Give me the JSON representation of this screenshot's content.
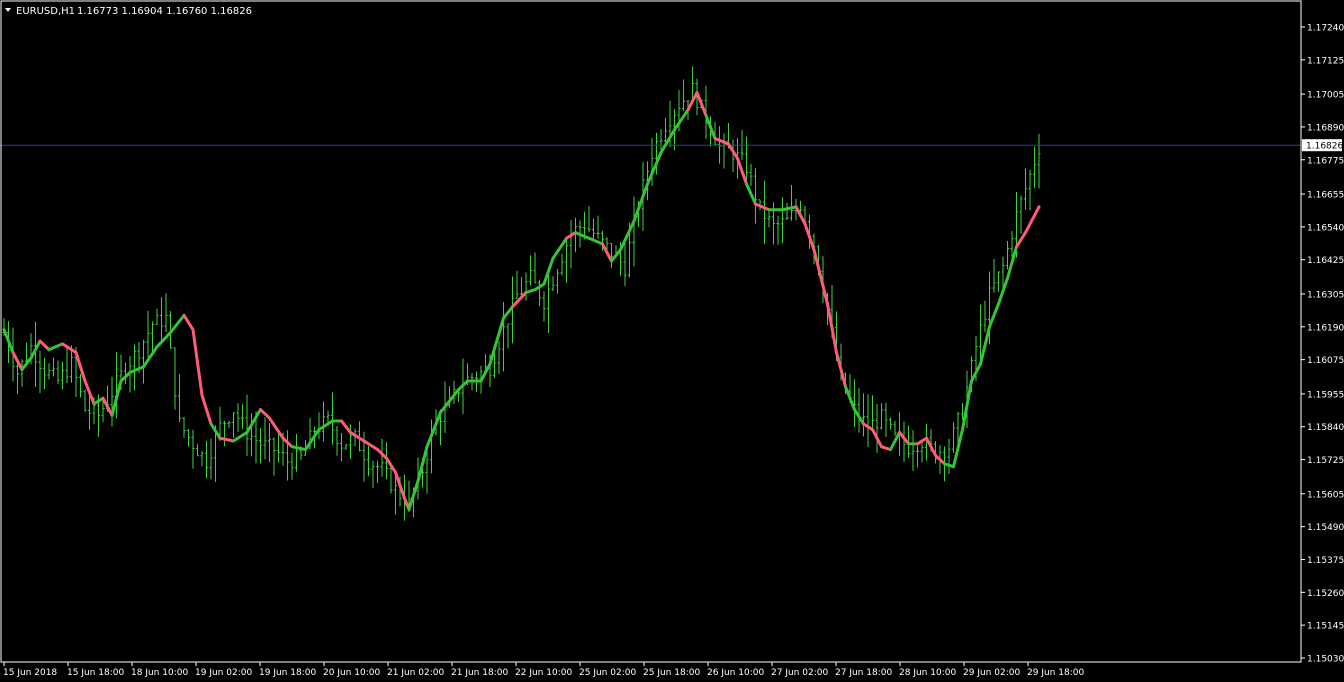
{
  "header": {
    "symbol_timeframe": "EURUSD,H1",
    "ohlc": "1.16773 1.16904 1.16760 1.16826"
  },
  "current_price_label": "1.16826",
  "colors": {
    "background": "#000000",
    "frame": "#ffffff",
    "bars": "#3fd23f",
    "ma_up": "#35c435",
    "ma_down": "#ff5a7a",
    "price_line": "#2b3ea8",
    "text": "#ffffff"
  },
  "chart_data": {
    "type": "ohlc-bar",
    "symbol": "EURUSD",
    "timeframe": "H1",
    "ylim": [
      1.1503,
      1.173
    ],
    "y_ticks": [
      "1.17240",
      "1.17125",
      "1.17005",
      "1.16890",
      "1.16775",
      "1.16655",
      "1.16540",
      "1.16425",
      "1.16305",
      "1.16190",
      "1.16075",
      "1.15955",
      "1.15840",
      "1.15725",
      "1.15605",
      "1.15490",
      "1.15375",
      "1.15260",
      "1.15145",
      "1.15030"
    ],
    "x_ticks": [
      "15 Jun 2018",
      "15 Jun 18:00",
      "18 Jun 10:00",
      "19 Jun 02:00",
      "19 Jun 18:00",
      "20 Jun 10:00",
      "21 Jun 02:00",
      "21 Jun 18:00",
      "22 Jun 10:00",
      "25 Jun 02:00",
      "25 Jun 18:00",
      "26 Jun 10:00",
      "27 Jun 02:00",
      "27 Jun 18:00",
      "28 Jun 10:00",
      "29 Jun 02:00",
      "29 Jun 18:00"
    ],
    "current_price": 1.16826,
    "close_path": [
      [
        0,
        1.1617
      ],
      [
        3,
        1.1603
      ],
      [
        6,
        1.1612
      ],
      [
        9,
        1.1604
      ],
      [
        12,
        1.16
      ],
      [
        15,
        1.1606
      ],
      [
        18,
        1.159
      ],
      [
        21,
        1.1588
      ],
      [
        24,
        1.1596
      ],
      [
        27,
        1.1605
      ],
      [
        30,
        1.1611
      ],
      [
        33,
        1.162
      ],
      [
        36,
        1.1622
      ],
      [
        39,
        1.1585
      ],
      [
        42,
        1.1578
      ],
      [
        45,
        1.1572
      ],
      [
        48,
        1.1584
      ],
      [
        51,
        1.159
      ],
      [
        54,
        1.1582
      ],
      [
        57,
        1.1578
      ],
      [
        60,
        1.1576
      ],
      [
        63,
        1.1572
      ],
      [
        66,
        1.1573
      ],
      [
        69,
        1.1583
      ],
      [
        72,
        1.1586
      ],
      [
        75,
        1.1578
      ],
      [
        78,
        1.158
      ],
      [
        81,
        1.1572
      ],
      [
        84,
        1.1569
      ],
      [
        87,
        1.1562
      ],
      [
        90,
        1.1557
      ],
      [
        93,
        1.1569
      ],
      [
        96,
        1.1586
      ],
      [
        99,
        1.1592
      ],
      [
        102,
        1.16
      ],
      [
        105,
        1.1602
      ],
      [
        108,
        1.1605
      ],
      [
        111,
        1.1618
      ],
      [
        114,
        1.163
      ],
      [
        117,
        1.1636
      ],
      [
        120,
        1.1628
      ],
      [
        123,
        1.164
      ],
      [
        126,
        1.1652
      ],
      [
        129,
        1.1655
      ],
      [
        132,
        1.165
      ],
      [
        135,
        1.1645
      ],
      [
        138,
        1.164
      ],
      [
        141,
        1.1662
      ],
      [
        144,
        1.168
      ],
      [
        147,
        1.169
      ],
      [
        150,
        1.1697
      ],
      [
        153,
        1.1702
      ],
      [
        156,
        1.1692
      ],
      [
        159,
        1.1682
      ],
      [
        162,
        1.168
      ],
      [
        165,
        1.1675
      ],
      [
        168,
        1.166
      ],
      [
        171,
        1.1654
      ],
      [
        174,
        1.1656
      ],
      [
        177,
        1.1662
      ],
      [
        180,
        1.1648
      ],
      [
        183,
        1.1625
      ],
      [
        186,
        1.16
      ],
      [
        189,
        1.159
      ],
      [
        192,
        1.1584
      ],
      [
        195,
        1.1587
      ],
      [
        198,
        1.158
      ],
      [
        201,
        1.1577
      ],
      [
        204,
        1.1579
      ],
      [
        207,
        1.1575
      ],
      [
        210,
        1.1577
      ],
      [
        213,
        1.159
      ],
      [
        216,
        1.1612
      ],
      [
        219,
        1.163
      ],
      [
        222,
        1.164
      ],
      [
        225,
        1.1658
      ],
      [
        228,
        1.1672
      ],
      [
        230,
        1.1682
      ]
    ],
    "ma_points": [
      [
        0,
        1.1618,
        "up"
      ],
      [
        2,
        1.161,
        "up"
      ],
      [
        4,
        1.1604,
        "down"
      ],
      [
        6,
        1.1608,
        "up"
      ],
      [
        8,
        1.1614,
        "up"
      ],
      [
        10,
        1.1611,
        "down"
      ],
      [
        13,
        1.1613,
        "up"
      ],
      [
        16,
        1.161,
        "down"
      ],
      [
        18,
        1.16,
        "down"
      ],
      [
        20,
        1.1592,
        "down"
      ],
      [
        22,
        1.1594,
        "up"
      ],
      [
        24,
        1.1588,
        "down"
      ],
      [
        26,
        1.16,
        "up"
      ],
      [
        28,
        1.1603,
        "up"
      ],
      [
        31,
        1.1605,
        "up"
      ],
      [
        34,
        1.1612,
        "up"
      ],
      [
        37,
        1.1617,
        "up"
      ],
      [
        40,
        1.1623,
        "up"
      ],
      [
        42,
        1.1618,
        "down"
      ],
      [
        44,
        1.1595,
        "down"
      ],
      [
        46,
        1.1585,
        "down"
      ],
      [
        48,
        1.158,
        "up"
      ],
      [
        51,
        1.1579,
        "down"
      ],
      [
        54,
        1.1582,
        "up"
      ],
      [
        57,
        1.159,
        "up"
      ],
      [
        59,
        1.1587,
        "down"
      ],
      [
        62,
        1.158,
        "down"
      ],
      [
        64,
        1.1577,
        "down"
      ],
      [
        67,
        1.1576,
        "up"
      ],
      [
        70,
        1.1583,
        "up"
      ],
      [
        73,
        1.1586,
        "up"
      ],
      [
        75,
        1.1586,
        "up"
      ],
      [
        77,
        1.1582,
        "down"
      ],
      [
        80,
        1.1579,
        "down"
      ],
      [
        83,
        1.1576,
        "down"
      ],
      [
        85,
        1.1573,
        "down"
      ],
      [
        87,
        1.1568,
        "down"
      ],
      [
        89,
        1.1559,
        "down"
      ],
      [
        90,
        1.1555,
        "down"
      ],
      [
        92,
        1.1565,
        "up"
      ],
      [
        94,
        1.1577,
        "up"
      ],
      [
        97,
        1.1589,
        "up"
      ],
      [
        99,
        1.1593,
        "up"
      ],
      [
        101,
        1.1597,
        "up"
      ],
      [
        103,
        1.16,
        "up"
      ],
      [
        106,
        1.16,
        "up"
      ],
      [
        108,
        1.1606,
        "up"
      ],
      [
        111,
        1.1622,
        "up"
      ],
      [
        113,
        1.1626,
        "up"
      ],
      [
        116,
        1.1631,
        "down"
      ],
      [
        118,
        1.1632,
        "up"
      ],
      [
        120,
        1.1634,
        "up"
      ],
      [
        122,
        1.1643,
        "up"
      ],
      [
        125,
        1.165,
        "up"
      ],
      [
        127,
        1.1652,
        "down"
      ],
      [
        130,
        1.165,
        "up"
      ],
      [
        133,
        1.1648,
        "up"
      ],
      [
        135,
        1.1642,
        "down"
      ],
      [
        137,
        1.1646,
        "up"
      ],
      [
        140,
        1.1656,
        "up"
      ],
      [
        143,
        1.1669,
        "up"
      ],
      [
        146,
        1.168,
        "up"
      ],
      [
        149,
        1.1688,
        "up"
      ],
      [
        152,
        1.1695,
        "up"
      ],
      [
        154,
        1.1701,
        "down"
      ],
      [
        156,
        1.1693,
        "down"
      ],
      [
        158,
        1.1685,
        "up"
      ],
      [
        161,
        1.1683,
        "down"
      ],
      [
        163,
        1.1678,
        "down"
      ],
      [
        165,
        1.1669,
        "down"
      ],
      [
        167,
        1.1662,
        "up"
      ],
      [
        170,
        1.166,
        "down"
      ],
      [
        173,
        1.166,
        "up"
      ],
      [
        176,
        1.1661,
        "up"
      ],
      [
        178,
        1.1655,
        "down"
      ],
      [
        180,
        1.1646,
        "down"
      ],
      [
        183,
        1.1627,
        "down"
      ],
      [
        185,
        1.161,
        "down"
      ],
      [
        187,
        1.1598,
        "down"
      ],
      [
        189,
        1.159,
        "up"
      ],
      [
        191,
        1.1585,
        "up"
      ],
      [
        193,
        1.1583,
        "down"
      ],
      [
        195,
        1.1577,
        "down"
      ],
      [
        197,
        1.1576,
        "down"
      ],
      [
        199,
        1.1582,
        "up"
      ],
      [
        201,
        1.1578,
        "down"
      ],
      [
        203,
        1.1578,
        "up"
      ],
      [
        205,
        1.158,
        "down"
      ],
      [
        207,
        1.1574,
        "down"
      ],
      [
        209,
        1.1571,
        "down"
      ],
      [
        211,
        1.157,
        "up"
      ],
      [
        213,
        1.1583,
        "up"
      ],
      [
        215,
        1.16,
        "up"
      ],
      [
        217,
        1.1606,
        "up"
      ],
      [
        219,
        1.1619,
        "up"
      ],
      [
        221,
        1.1627,
        "up"
      ],
      [
        223,
        1.1636,
        "up"
      ],
      [
        225,
        1.1647,
        "up"
      ],
      [
        227,
        1.1652,
        "down"
      ],
      [
        229,
        1.1658,
        "down"
      ],
      [
        230,
        1.1661,
        "down"
      ]
    ]
  }
}
